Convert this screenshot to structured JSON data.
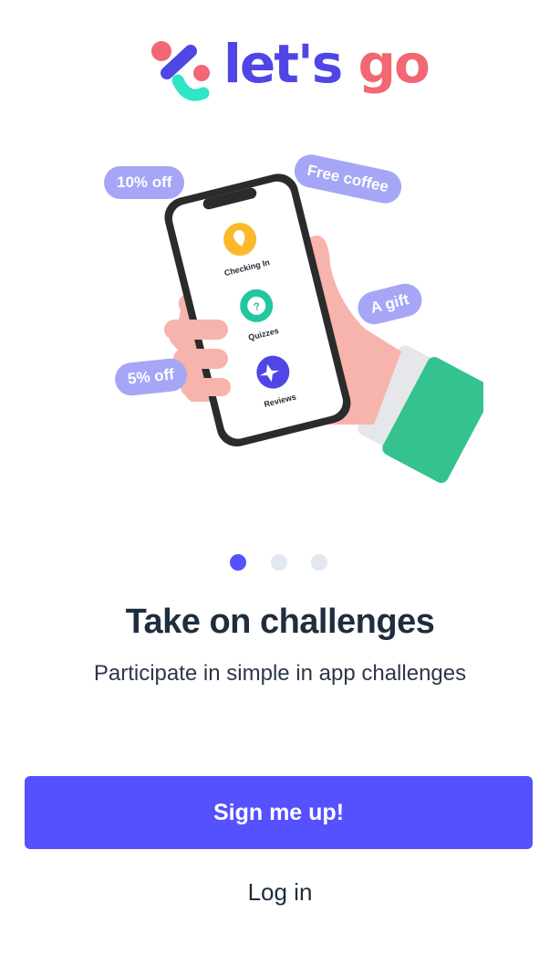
{
  "brand": {
    "name_part1": "let's",
    "name_part2": "go",
    "colors": {
      "primary": "#4f46e5",
      "accent": "#f26773",
      "teal": "#2ee6c4"
    }
  },
  "illustration": {
    "pills": [
      {
        "label": "10% off"
      },
      {
        "label": "Free coffee"
      },
      {
        "label": "A gift"
      },
      {
        "label": "5% off"
      }
    ],
    "phone_items": [
      {
        "label": "Checking In",
        "icon": "pin-check-icon",
        "color": "#fbb92a"
      },
      {
        "label": "Quizzes",
        "icon": "question-icon",
        "color": "#21c79f"
      },
      {
        "label": "Reviews",
        "icon": "sparkle-plus-icon",
        "color": "#4f46e5"
      }
    ]
  },
  "pagination": {
    "count": 3,
    "active": 0,
    "active_color": "#5551ff",
    "inactive_color": "#e2e8f0"
  },
  "onboarding": {
    "title": "Take on challenges",
    "subtitle": "Participate in simple in app challenges"
  },
  "actions": {
    "signup_label": "Sign me up!",
    "login_label": "Log in"
  }
}
